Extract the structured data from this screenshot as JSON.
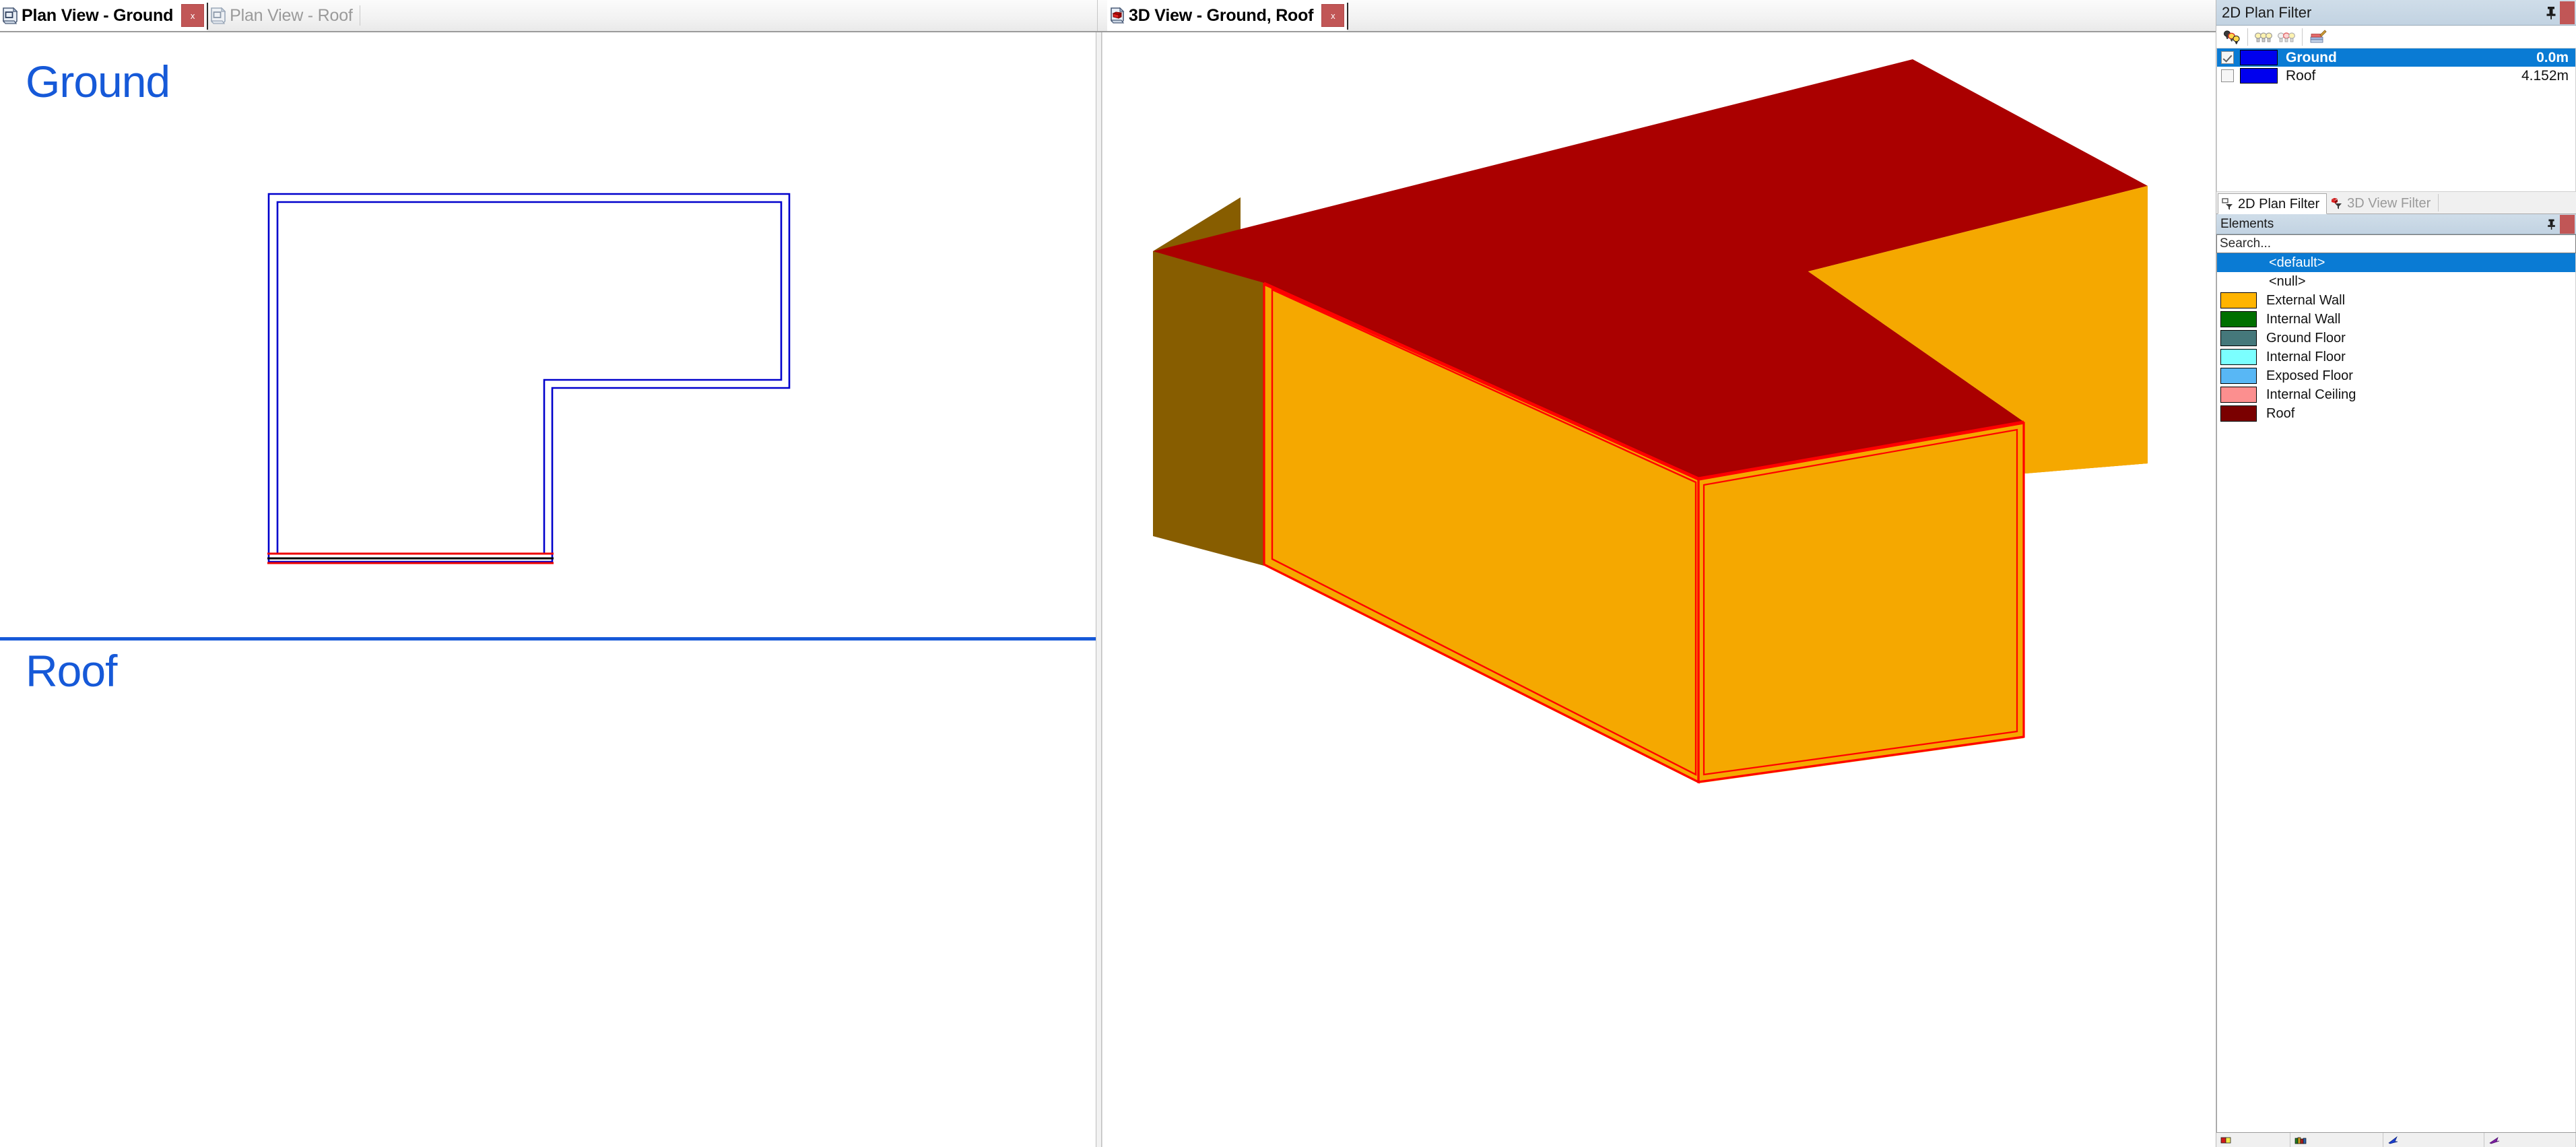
{
  "tabs": {
    "left_group": [
      {
        "label": "Plan View - Ground",
        "icon": "plan-view-icon",
        "active": true,
        "closable": true
      },
      {
        "label": "Plan View - Roof",
        "icon": "plan-view-icon",
        "active": false,
        "closable": false
      }
    ],
    "right_group": [
      {
        "label": "3D View - Ground, Roof",
        "icon": "view-3d-icon",
        "active": true,
        "closable": true
      }
    ],
    "close_glyph": "x"
  },
  "plan_view": {
    "title_ground": "Ground",
    "title_roof": "Roof",
    "outline_color": "#0000cc",
    "selected_color": "#ee0000",
    "selected_core_color": "#000000",
    "divider_color": "#1659d8",
    "label_color": "#1659d8"
  },
  "view3d": {
    "roof_color": "#aa0000",
    "wall_front_color": "#f5a800",
    "wall_side_color": "#875d00",
    "wall_right_color": "#f0a000",
    "highlight_color": "#ff0000",
    "background": "#ffffff"
  },
  "dock": {
    "caption": "2D Plan Filter",
    "pin_icon": "pin-icon",
    "close_icon": "close-icon",
    "toolbar": [
      {
        "name": "filter-lights-icon",
        "title": "Filter"
      },
      {
        "name": "lights-on-icon",
        "title": "All On"
      },
      {
        "name": "lights-off-icon",
        "title": "All Off"
      },
      {
        "name": "edit-colours-icon",
        "title": "Edit Colours"
      }
    ],
    "layers": {
      "rows": [
        {
          "name": "Ground",
          "level": "0.0m",
          "color": "#0000ee",
          "checked": true,
          "selected": true
        },
        {
          "name": "Roof",
          "level": "4.152m",
          "color": "#0000ee",
          "checked": false,
          "selected": false
        }
      ]
    },
    "filter_tabs": [
      {
        "label": "2D Plan Filter",
        "icon": "plan-filter-icon",
        "active": true
      },
      {
        "label": "3D View Filter",
        "icon": "view-filter-icon",
        "active": false
      }
    ],
    "elements_panel": {
      "caption": "Elements",
      "pin_icon": "pin-icon",
      "close_icon": "close-icon",
      "search_placeholder": "Search...",
      "search_value": "",
      "items": [
        {
          "label": "<default>",
          "color": null,
          "selected": true,
          "angled": true
        },
        {
          "label": "<null>",
          "color": null,
          "selected": false,
          "angled": true
        },
        {
          "label": "External Wall",
          "color": "#ffb400",
          "selected": false,
          "angled": false
        },
        {
          "label": "Internal Wall",
          "color": "#007000",
          "selected": false,
          "angled": false
        },
        {
          "label": "Ground Floor",
          "color": "#45787b",
          "selected": false,
          "angled": false
        },
        {
          "label": "Internal Floor",
          "color": "#7bffff",
          "selected": false,
          "angled": false
        },
        {
          "label": "Exposed Floor",
          "color": "#58b7f5",
          "selected": false,
          "angled": false
        },
        {
          "label": "Internal Ceiling",
          "color": "#fc8f8f",
          "selected": false,
          "angled": false
        },
        {
          "label": "Roof",
          "color": "#7a0000",
          "selected": false,
          "angled": false
        }
      ]
    },
    "status_cells": [
      {
        "icon": "colour-chip-icon"
      },
      {
        "icon": "books-icon"
      },
      {
        "icon": "blue-arrow-icon"
      },
      {
        "icon": "purple-arrow-icon"
      }
    ]
  }
}
